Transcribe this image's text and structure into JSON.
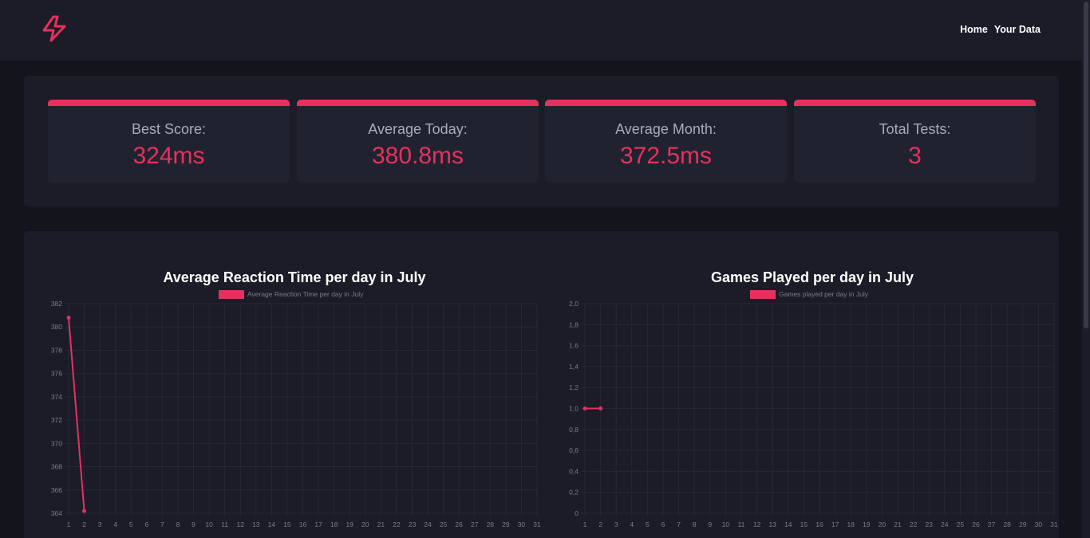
{
  "nav": {
    "home_label": "Home",
    "your_data_label": "Your Data",
    "logo_icon": "lightning-bolt-icon",
    "accent": "#e8305e"
  },
  "stats": [
    {
      "label": "Best Score:",
      "value": "324ms"
    },
    {
      "label": "Average Today:",
      "value": "380.8ms"
    },
    {
      "label": "Average Month:",
      "value": "372.5ms"
    },
    {
      "label": "Total Tests:",
      "value": "3"
    }
  ],
  "chart_data": [
    {
      "type": "line",
      "title": "Average Reaction Time per day in July",
      "legend": "Average Reaction Time per day in July",
      "x": [
        "1",
        "2",
        "3",
        "4",
        "5",
        "6",
        "7",
        "8",
        "9",
        "10",
        "11",
        "12",
        "13",
        "14",
        "15",
        "16",
        "17",
        "18",
        "19",
        "20",
        "21",
        "22",
        "23",
        "24",
        "25",
        "26",
        "27",
        "28",
        "29",
        "30",
        "31"
      ],
      "series": [
        {
          "name": "Average Reaction Time per day in July",
          "values": [
            380.8,
            364.2
          ]
        }
      ],
      "ylim": [
        364,
        382
      ],
      "yticks": [
        "382",
        "380",
        "378",
        "376",
        "374",
        "372",
        "370",
        "368",
        "366",
        "364"
      ],
      "grid": true,
      "legend_position": "top",
      "color": "#e8305e"
    },
    {
      "type": "line",
      "title": "Games Played per day in July",
      "legend": "Games played per day in July",
      "x": [
        "1",
        "2",
        "3",
        "4",
        "5",
        "6",
        "7",
        "8",
        "9",
        "10",
        "11",
        "12",
        "13",
        "14",
        "15",
        "16",
        "17",
        "18",
        "19",
        "20",
        "21",
        "22",
        "23",
        "24",
        "25",
        "26",
        "27",
        "28",
        "29",
        "30",
        "31"
      ],
      "series": [
        {
          "name": "Games played per day in July",
          "values": [
            1,
            1
          ]
        }
      ],
      "ylim": [
        0,
        2
      ],
      "yticks": [
        "2,0",
        "1,8",
        "1,6",
        "1,4",
        "1,2",
        "1,0",
        "0,8",
        "0,6",
        "0,4",
        "0,2",
        "0"
      ],
      "grid": true,
      "legend_position": "top",
      "color": "#e8305e"
    }
  ]
}
